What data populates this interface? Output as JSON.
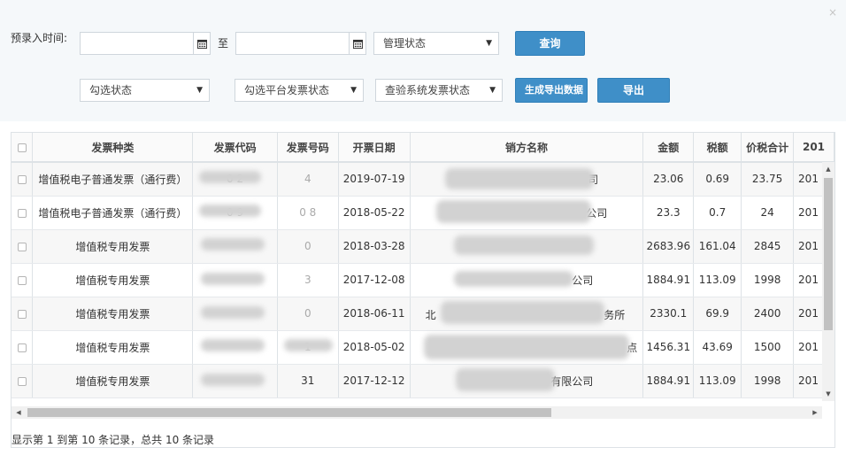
{
  "filters": {
    "preentry_time_label": "预录入时间:",
    "to_label": "至",
    "manage_status": "管理状态",
    "check_status": "勾选状态",
    "platform_status": "勾选平台发票状态",
    "verify_status": "查验系统发票状态",
    "query_button": "查询",
    "generate_button": "生成导出数据",
    "export_button": "导出",
    "close_symbol": "×"
  },
  "table": {
    "headers": [
      "发票种类",
      "发票代码",
      "发票号码",
      "开票日期",
      "销方名称",
      "金额",
      "税额",
      "价税合计",
      "201"
    ],
    "rows": [
      {
        "type": "增值税电子普通发票（通行费）",
        "code": "0          2",
        "number": "4       ",
        "date": "2019-07-19",
        "seller": "司",
        "amount": "23.06",
        "tax": "0.69",
        "total": "23.75",
        "extra": "201"
      },
      {
        "type": "增值税电子普通发票（通行费）",
        "code": "0          9",
        "number": "0       8",
        "date": "2018-05-22",
        "seller": "公司",
        "amount": "23.3",
        "tax": "0.7",
        "total": "24",
        "extra": "201"
      },
      {
        "type": "增值税专用发票",
        "code": "",
        "number": "0       ",
        "date": "2018-03-28",
        "seller": "",
        "amount": "2683.96",
        "tax": "161.04",
        "total": "2845",
        "extra": "201"
      },
      {
        "type": "增值税专用发票",
        "code": "",
        "number": "3       ",
        "date": "2017-12-08",
        "seller": "公司",
        "amount": "1884.91",
        "tax": "113.09",
        "total": "1998",
        "extra": "201"
      },
      {
        "type": "增值税专用发票",
        "code": "",
        "number": "0       ",
        "date": "2018-06-11",
        "seller_left": "北",
        "seller": "务所",
        "amount": "2330.1",
        "tax": "69.9",
        "total": "2400",
        "extra": "201"
      },
      {
        "type": "增值税专用发票",
        "code": "",
        "number": "1       ",
        "date": "2018-05-02",
        "seller": "点",
        "amount": "1456.31",
        "tax": "43.69",
        "total": "1500",
        "extra": "201"
      },
      {
        "type": "增值税专用发票",
        "code": "",
        "number": "31      ",
        "date": "2017-12-12",
        "seller": "有限公司",
        "amount": "1884.91",
        "tax": "113.09",
        "total": "1998",
        "extra": "201"
      }
    ]
  },
  "pagination": {
    "text": "显示第 1 到第 10 条记录，总共 10 条记录"
  }
}
